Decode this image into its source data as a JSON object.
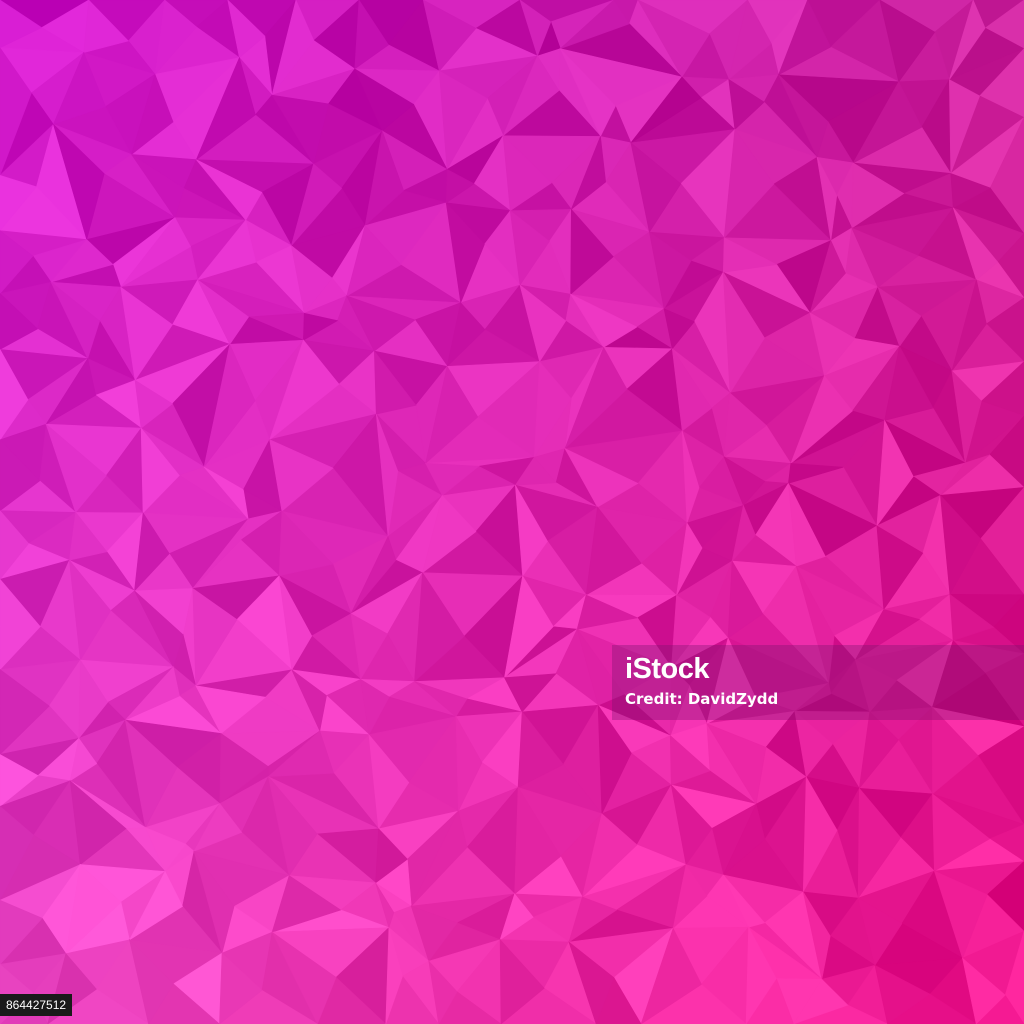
{
  "image": {
    "description_colors": {
      "top_left": "#cc10c8",
      "top_right": "#c8209a",
      "bottom_left": "#f04cc8",
      "bottom_right": "#f0148c",
      "center": "#e020b0"
    },
    "pattern": "low-poly-triangles"
  },
  "watermark": {
    "logo": "iStock",
    "credit": "Credit: DavidZydd"
  },
  "image_id": "864427512"
}
